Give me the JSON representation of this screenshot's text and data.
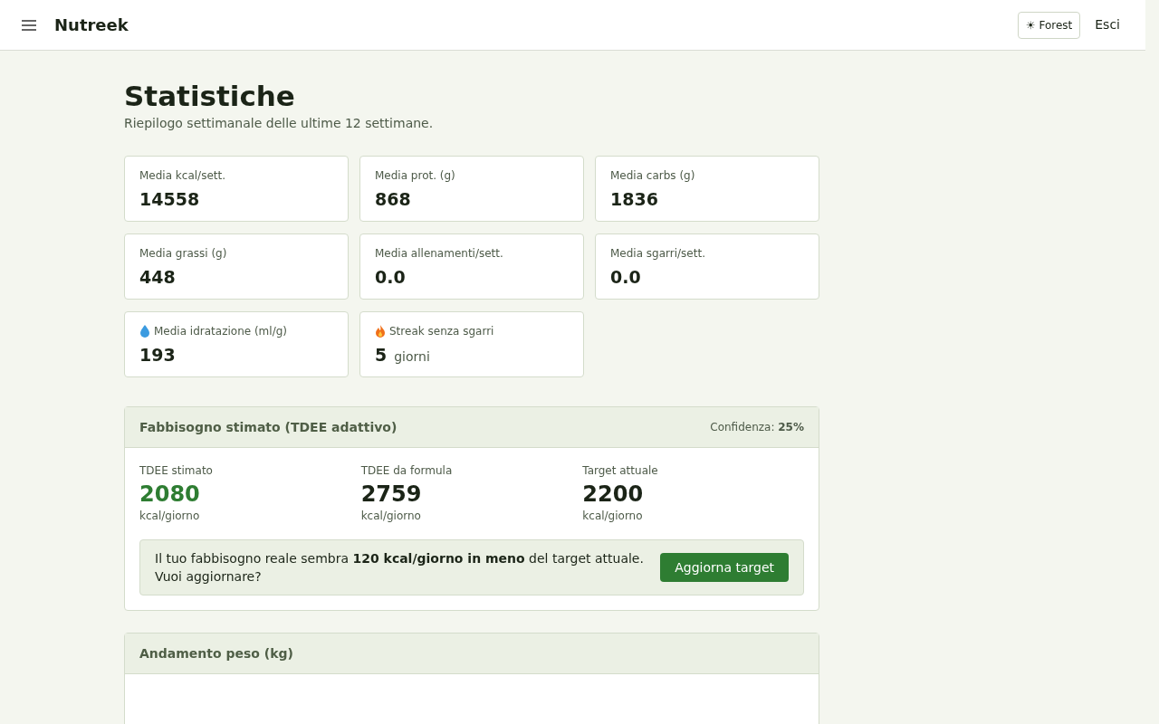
{
  "header": {
    "brand": "Nutreek",
    "theme_button": "☀ Forest",
    "logout": "Esci"
  },
  "page": {
    "title": "Statistiche",
    "subtitle": "Riepilogo settimanale delle ultime 12 settimane."
  },
  "stats": [
    {
      "kind": "plain",
      "label": "Media kcal/sett.",
      "value": "14558"
    },
    {
      "kind": "plain",
      "label": "Media prot. (g)",
      "value": "868"
    },
    {
      "kind": "plain",
      "label": "Media carbs (g)",
      "value": "1836"
    },
    {
      "kind": "plain",
      "label": "Media grassi (g)",
      "value": "448"
    },
    {
      "kind": "plain",
      "label": "Media allenamenti/sett.",
      "value": "0.0"
    },
    {
      "kind": "plain",
      "label": "Media sgarri/sett.",
      "value": "0.0"
    },
    {
      "kind": "water",
      "label": "Media idratazione (ml/g)",
      "value": "193"
    },
    {
      "kind": "streak",
      "label": "Streak senza sgarri",
      "value": "5",
      "unit": "giorni"
    }
  ],
  "tdee": {
    "title": "Fabbisogno stimato (TDEE adattivo)",
    "confidence": "Confidenza: **25%**",
    "metrics": [
      {
        "label": "TDEE stimato",
        "value": "2080",
        "unit": "kcal/giorno",
        "highlighted": true
      },
      {
        "label": "TDEE da formula",
        "value": "2759",
        "unit": "kcal/giorno",
        "highlighted": false
      },
      {
        "label": "Target attuale",
        "value": "2200",
        "unit": "kcal/giorno",
        "highlighted": false
      }
    ],
    "message": "Il tuo fabbisogno reale sembra **120 kcal/giorno in meno** del target attuale. Vuoi aggiornare?",
    "button": "Aggiorna target"
  },
  "weight": {
    "title": "Andamento peso (kg)"
  }
}
